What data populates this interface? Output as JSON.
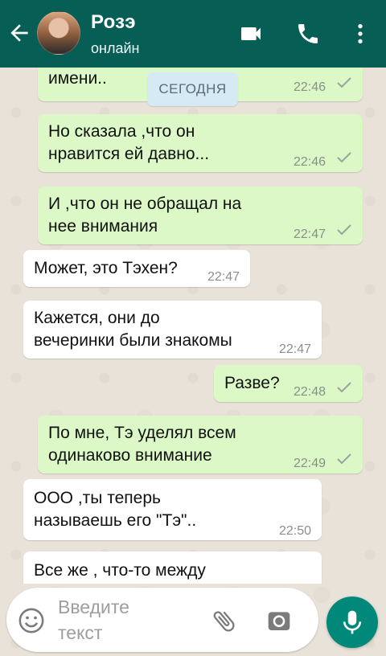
{
  "header": {
    "contact_name": "Розэ",
    "status": "онлайн"
  },
  "date_chip": "СЕГОДНЯ",
  "messages": [
    {
      "dir": "out",
      "lines": [
        "имени.."
      ],
      "time": "22:46"
    },
    {
      "dir": "out",
      "lines": [
        "Но сказала ,что он",
        "нравится ей давно..."
      ],
      "time": "22:46"
    },
    {
      "dir": "out",
      "lines": [
        "И ,что он не обращал на",
        "нее внимания"
      ],
      "time": "22:47"
    },
    {
      "dir": "in",
      "lines": [
        "Может, это Тэхен?"
      ],
      "time": "22:47"
    },
    {
      "dir": "in",
      "lines": [
        "Кажется, они до",
        "вечеринки были знакомы"
      ],
      "time": "22:47"
    },
    {
      "dir": "out",
      "lines": [
        "Разве?"
      ],
      "time": "22:48"
    },
    {
      "dir": "out",
      "lines": [
        "По мне, Тэ уделял всем",
        "одинаково внимание"
      ],
      "time": "22:49"
    },
    {
      "dir": "in",
      "lines": [
        "ООО ,ты теперь",
        "называешь его \"Тэ\".."
      ],
      "time": "22:50"
    },
    {
      "dir": "in",
      "lines": [
        "Все же , что-то между"
      ],
      "time": ""
    }
  ],
  "input": {
    "placeholder_line1": "Введите",
    "placeholder_line2": "текст"
  },
  "colors": {
    "header": "#075e54",
    "outgoing_bubble": "#dcf8c6",
    "incoming_bubble": "#ffffff",
    "mic_button": "#00897b"
  }
}
